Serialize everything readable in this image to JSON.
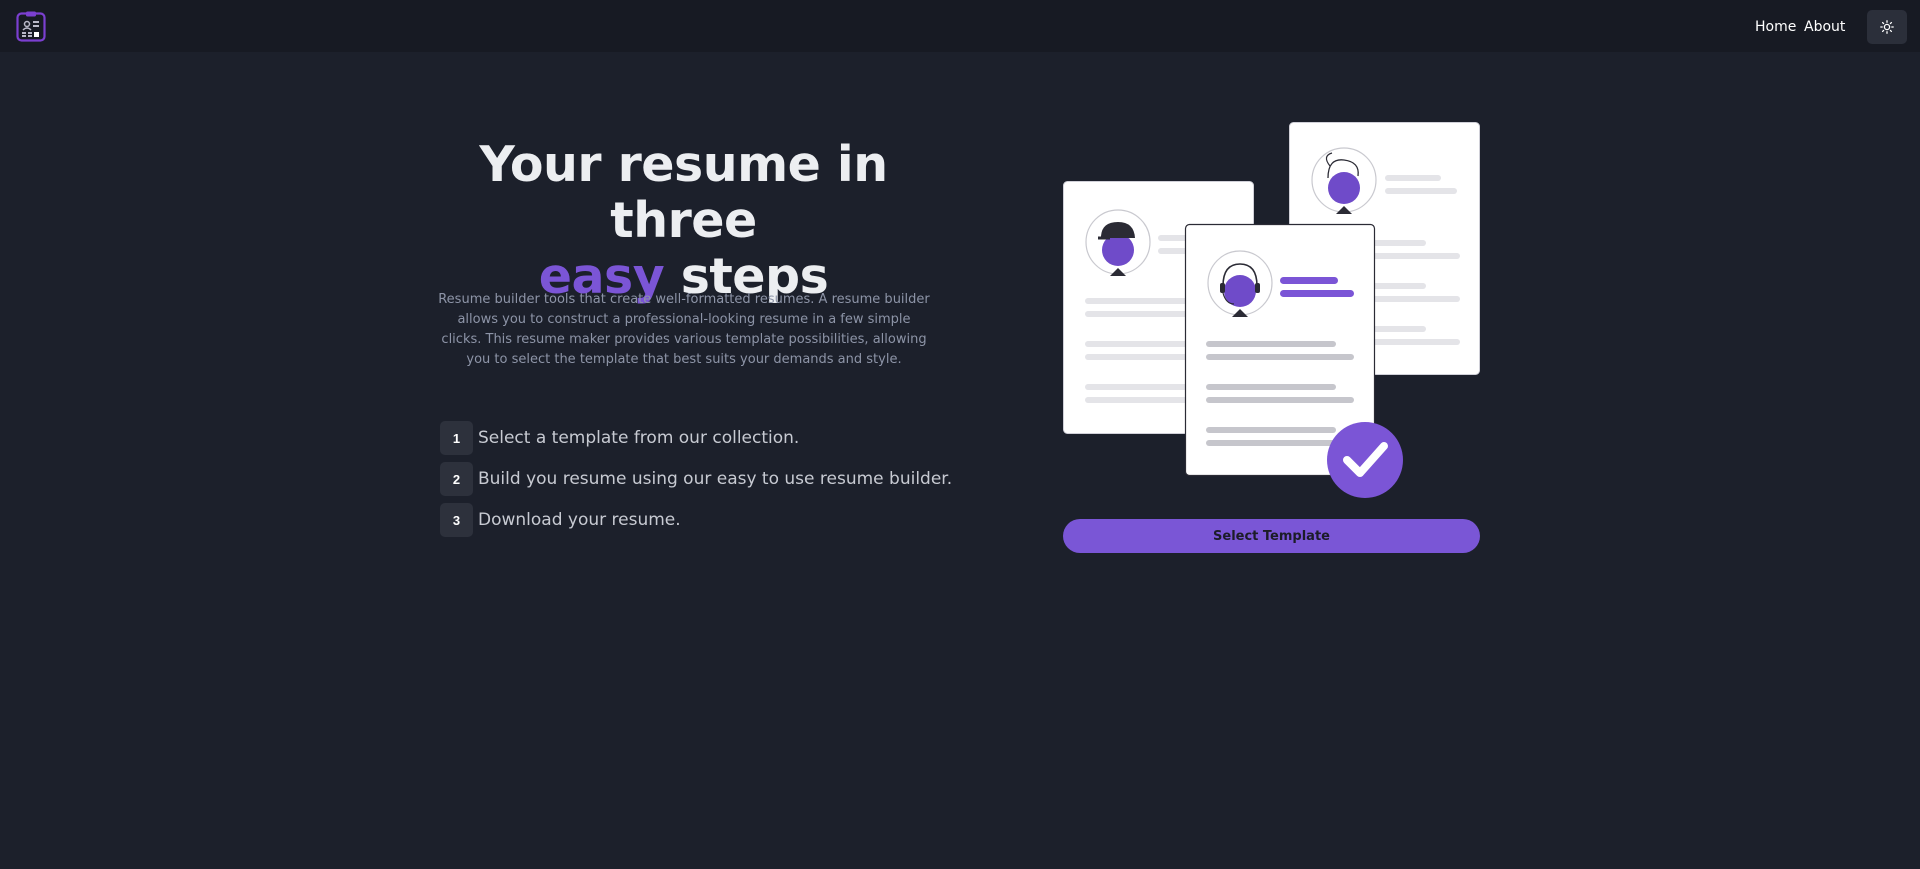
{
  "nav": {
    "logo_icon": "resume-builder-logo-icon",
    "home_label": "Home",
    "about_label": "About",
    "theme_toggle_icon": "sun-icon"
  },
  "hero": {
    "title_line1": "Your resume in three",
    "title_accent": "easy",
    "title_rest": " steps",
    "description": "Resume builder tools that create well-formatted resumes. A resume builder allows you to construct a professional-looking resume in a few simple clicks. This resume maker provides various template possibilities, allowing you to select the template that best suits your demands and style."
  },
  "steps": [
    {
      "number": "1",
      "text": "Select a template from our collection."
    },
    {
      "number": "2",
      "text": "Build you resume using our easy to use resume builder."
    },
    {
      "number": "3",
      "text": "Download your resume."
    }
  ],
  "cta": {
    "select_template_label": "Select Template"
  },
  "colors": {
    "background": "#1c202b",
    "navbar": "#171a23",
    "accent": "#7b55d6",
    "button": "#7a56d6"
  }
}
